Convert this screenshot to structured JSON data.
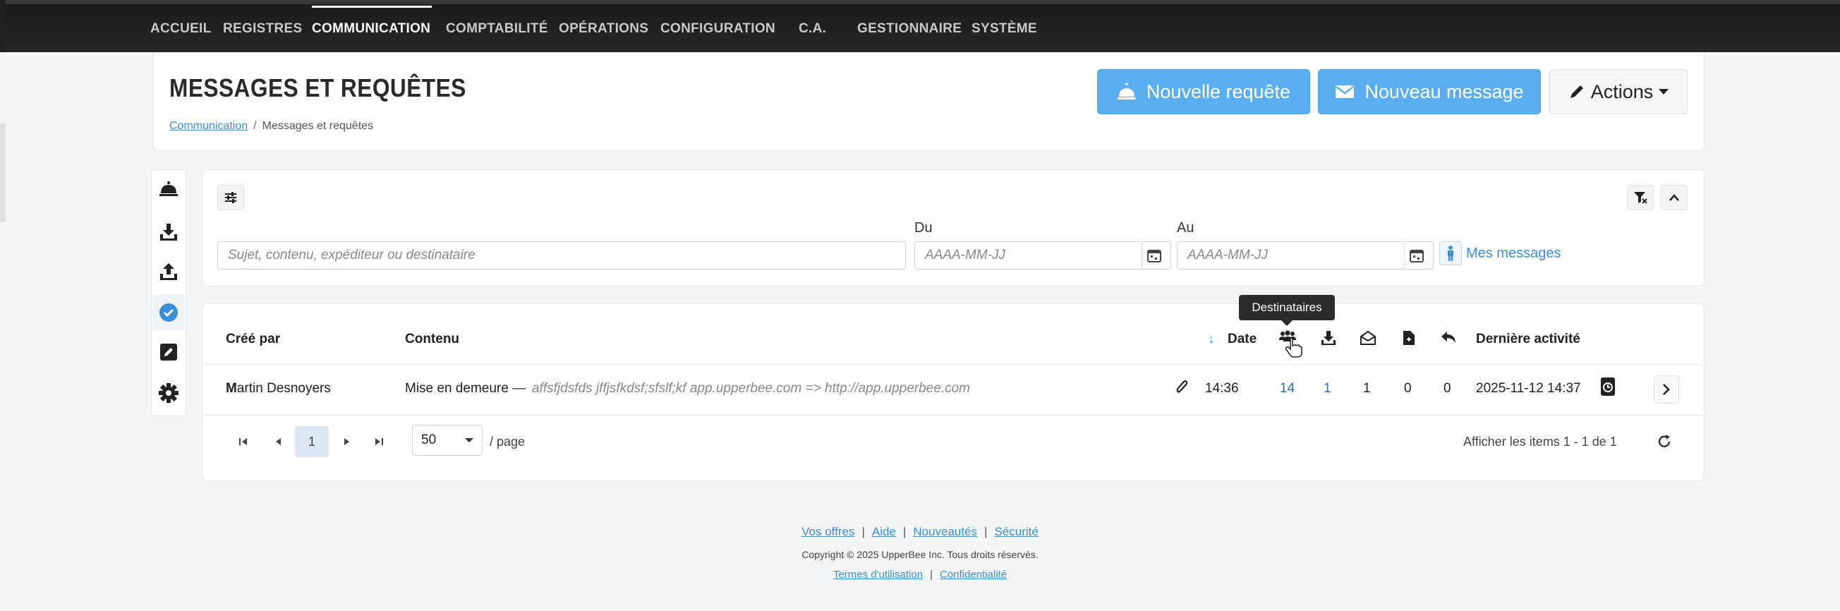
{
  "nav": {
    "items": [
      {
        "label": "ACCUEIL"
      },
      {
        "label": "REGISTRES"
      },
      {
        "label": "COMMUNICATION",
        "active": true
      },
      {
        "label": "COMPTABILITÉ"
      },
      {
        "label": "OPÉRATIONS"
      },
      {
        "label": "CONFIGURATION"
      },
      {
        "label": "C.A."
      },
      {
        "label": "GESTIONNAIRE"
      },
      {
        "label": "SYSTÈME"
      }
    ]
  },
  "header": {
    "title": "MESSAGES ET REQUÊTES",
    "breadcrumb": {
      "link": "Communication",
      "separator": "/",
      "current": "Messages et requêtes"
    },
    "buttons": {
      "new_request": "Nouvelle requête",
      "new_message": "Nouveau message",
      "actions": "Actions"
    }
  },
  "sidebar": {
    "icons": [
      "bell-icon",
      "inbox-download-icon",
      "outbox-upload-icon",
      "check-circle-icon",
      "edit-square-icon",
      "gear-icon"
    ]
  },
  "filters": {
    "search_placeholder": "Sujet, contenu, expéditeur ou destinataire",
    "from_label": "Du",
    "from_placeholder": "AAAA-MM-JJ",
    "to_label": "Au",
    "to_placeholder": "AAAA-MM-JJ",
    "my_messages": "Mes messages"
  },
  "grid": {
    "columns": {
      "created_by": "Créé par",
      "content": "Contenu",
      "date": "Date",
      "last_activity": "Dernière activité"
    },
    "tooltip": "Destinataires",
    "rows": [
      {
        "created_by_initial": "M",
        "created_by_rest": "artin Desnoyers",
        "subject": "Mise en demeure —",
        "preview": "affsfjdsfds jffjsfkdsf;sfslf;kf   app.upperbee.com => http://app.upperbee.com",
        "time": "14:36",
        "recipients": "14",
        "downloads": "1",
        "opened": "1",
        "documents": "0",
        "replies": "0",
        "last_activity": "2025-11-12 14:37"
      }
    ],
    "pager": {
      "current_page": "1",
      "page_size": "50",
      "per_page_label": "/ page",
      "summary": "Afficher les items 1 - 1 de 1"
    }
  },
  "footer": {
    "links": [
      "Vos offres",
      "Aide",
      "Nouveautés",
      "Sécurité"
    ],
    "copyright": "Copyright © 2025 UpperBee Inc. Tous droits réservés.",
    "legal_links": [
      "Termes d'utilisation",
      "Confidentialité"
    ]
  },
  "colors": {
    "primary_button": "#5aaef0",
    "link": "#3b8fd9",
    "navbar": "#222222"
  }
}
